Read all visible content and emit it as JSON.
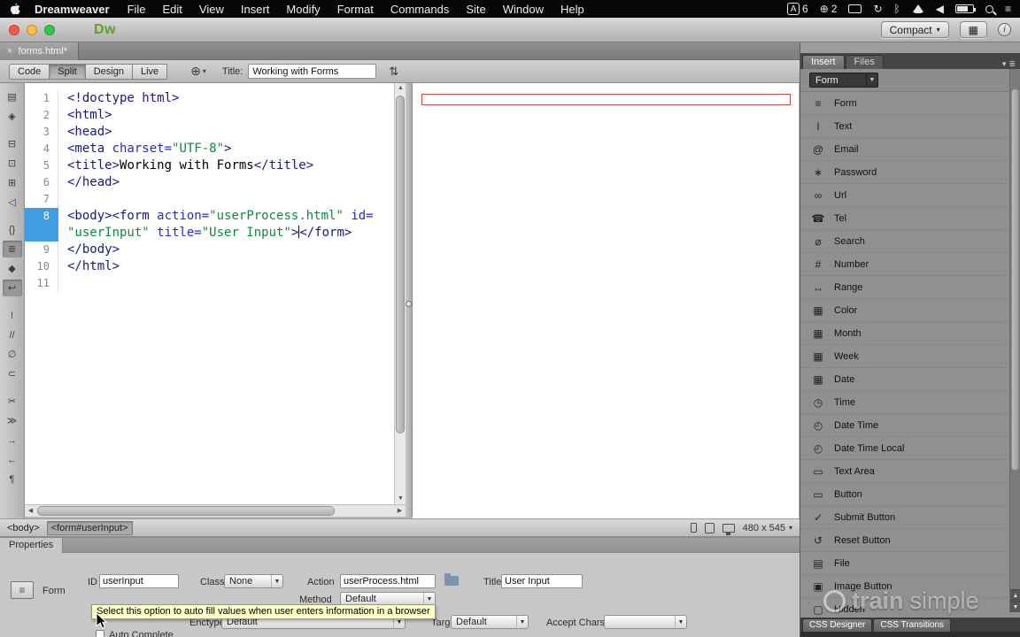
{
  "menubar": {
    "app_name": "Dreamweaver",
    "menus": [
      {
        "label": "File"
      },
      {
        "label": "Edit"
      },
      {
        "label": "View"
      },
      {
        "label": "Insert"
      },
      {
        "label": "Modify"
      },
      {
        "label": "Format"
      },
      {
        "label": "Commands"
      },
      {
        "label": "Site"
      },
      {
        "label": "Window"
      },
      {
        "label": "Help"
      }
    ],
    "input_badge": "6",
    "network_badge": "2"
  },
  "icons": {
    "input_a": "A",
    "globe": "⊕",
    "sync": "↻",
    "bluetooth": "ᛒ",
    "volume": "◀",
    "hamburger": "≡",
    "chevron_small": "▾",
    "chevron_down": "▼",
    "file_transfer": "⇅",
    "workspace_grid": "▦",
    "info": "i",
    "scroll_up": "▲",
    "scroll_down": "▼",
    "scroll_left": "◀",
    "scroll_right": "▶",
    "panel_menu": "≣",
    "form_plate": "≡"
  },
  "titlebar": {
    "logo": "Dw",
    "workspace_button": "Compact"
  },
  "doc_tab": {
    "close": "×",
    "label": "forms.html*"
  },
  "doc_toolbar": {
    "view_buttons": [
      {
        "label": "Code",
        "state": ""
      },
      {
        "label": "Split",
        "state": "active"
      },
      {
        "label": "Design",
        "state": ""
      },
      {
        "label": "Live",
        "state": ""
      }
    ],
    "title_label": "Title:",
    "title_value": "Working with Forms"
  },
  "left_toolbar": {
    "icons": [
      {
        "name": "open-documents-icon",
        "glyph": "▤",
        "state": ""
      },
      {
        "name": "code-navigator-icon",
        "glyph": "◈",
        "state": ""
      },
      {
        "name": "collapse-full-tag-icon",
        "glyph": "⊟",
        "state": ""
      },
      {
        "name": "collapse-selection-icon",
        "glyph": "⊡",
        "state": ""
      },
      {
        "name": "expand-all-icon",
        "glyph": "⊞",
        "state": ""
      },
      {
        "name": "select-parent-tag-icon",
        "glyph": "◁",
        "state": ""
      },
      {
        "name": "balance-braces-icon",
        "glyph": "{}",
        "state": ""
      },
      {
        "name": "line-numbers-icon",
        "glyph": "≣",
        "state": "active"
      },
      {
        "name": "highlight-invalid-code-icon",
        "glyph": "◆",
        "state": ""
      },
      {
        "name": "word-wrap-icon",
        "glyph": "↩",
        "state": "active"
      },
      {
        "name": "syntax-error-alerts-icon",
        "glyph": "!",
        "state": ""
      },
      {
        "name": "apply-comment-icon",
        "glyph": "//",
        "state": ""
      },
      {
        "name": "remove-comment-icon",
        "glyph": "∅",
        "state": ""
      },
      {
        "name": "wrap-tag-icon",
        "glyph": "⊂",
        "state": ""
      },
      {
        "name": "recent-snippets-icon",
        "glyph": "✂",
        "state": ""
      },
      {
        "name": "move-css-icon",
        "glyph": "≫",
        "state": ""
      },
      {
        "name": "indent-icon",
        "glyph": "→",
        "state": ""
      },
      {
        "name": "outdent-icon",
        "glyph": "←",
        "state": ""
      },
      {
        "name": "format-source-icon",
        "glyph": "¶",
        "state": ""
      }
    ]
  },
  "code": {
    "line1": {
      "num": "1",
      "t1": "<!doctype html>"
    },
    "line2": {
      "num": "2",
      "t1": "<html>"
    },
    "line3": {
      "num": "3",
      "t1": "<head>"
    },
    "line4": {
      "num": "4",
      "t1": "<meta ",
      "a1": "charset=",
      "s1": "\"UTF-8\"",
      "t2": ">"
    },
    "line5": {
      "num": "5",
      "t1": "<title>",
      "x1": "Working with Forms",
      "t2": "</title>"
    },
    "line6": {
      "num": "6",
      "t1": "</head>"
    },
    "line7": {
      "num": "7"
    },
    "line8a": {
      "num": "8",
      "t1": "<body><form ",
      "a1": "action=",
      "s1": "\"userProcess.html\"",
      "a2": " id="
    },
    "line8b": {
      "s1": "\"userInput\"",
      "a1": " title=",
      "s2": "\"User Input\"",
      "t1": ">",
      "t2": "</form>"
    },
    "line9": {
      "num": "9",
      "t1": "</body>"
    },
    "line10": {
      "num": "10",
      "t1": "</html>"
    },
    "line11": {
      "num": "11"
    }
  },
  "status_bar": {
    "tag_body": "<body>",
    "tag_form": "<form#userInput>",
    "window_size": "480 x 545"
  },
  "insert_panel": {
    "tab_insert": "Insert",
    "tab_files": "Files",
    "category_select": "Form",
    "items": [
      {
        "icon": "form-icon",
        "glyph": "≡",
        "label": "Form"
      },
      {
        "icon": "text-field-icon",
        "glyph": "I",
        "label": "Text"
      },
      {
        "icon": "email-icon",
        "glyph": "@",
        "label": "Email"
      },
      {
        "icon": "password-icon",
        "glyph": "∗",
        "label": "Password"
      },
      {
        "icon": "url-icon",
        "glyph": "∞",
        "label": "Url"
      },
      {
        "icon": "tel-icon",
        "glyph": "☎",
        "label": "Tel"
      },
      {
        "icon": "search-icon",
        "glyph": "⌀",
        "label": "Search"
      },
      {
        "icon": "number-icon",
        "glyph": "#",
        "label": "Number"
      },
      {
        "icon": "range-icon",
        "glyph": "↔",
        "label": "Range"
      },
      {
        "icon": "color-icon",
        "glyph": "▦",
        "label": "Color"
      },
      {
        "icon": "month-icon",
        "glyph": "▦",
        "label": "Month"
      },
      {
        "icon": "week-icon",
        "glyph": "▦",
        "label": "Week"
      },
      {
        "icon": "date-icon",
        "glyph": "▦",
        "label": "Date"
      },
      {
        "icon": "time-icon",
        "glyph": "◷",
        "label": "Time"
      },
      {
        "icon": "date-time-icon",
        "glyph": "◴",
        "label": "Date Time"
      },
      {
        "icon": "date-time-local-icon",
        "glyph": "◴",
        "label": "Date Time Local"
      },
      {
        "icon": "text-area-icon",
        "glyph": "▭",
        "label": "Text Area"
      },
      {
        "icon": "button-icon",
        "glyph": "▭",
        "label": "Button"
      },
      {
        "icon": "submit-button-icon",
        "glyph": "✓",
        "label": "Submit Button"
      },
      {
        "icon": "reset-button-icon",
        "glyph": "↺",
        "label": "Reset Button"
      },
      {
        "icon": "file-icon",
        "glyph": "▤",
        "label": "File"
      },
      {
        "icon": "image-button-icon",
        "glyph": "▣",
        "label": "Image Button"
      },
      {
        "icon": "hidden-icon",
        "glyph": "▢",
        "label": "Hidden"
      }
    ],
    "bottom_tabs": [
      {
        "label": "CSS Designer"
      },
      {
        "label": "CSS Transitions"
      }
    ]
  },
  "properties": {
    "tab_label": "Properties",
    "element_label": "Form",
    "id_label": "ID",
    "id_value": "userInput",
    "class_label": "Class",
    "class_value": "None",
    "action_label": "Action",
    "action_value": "userProcess.html",
    "title_label": "Title",
    "title_value": "User Input",
    "method_label": "Method",
    "method_value": "Default",
    "enctype_label": "Enctype",
    "enctype_value": "Default",
    "target_label": "Target",
    "target_value": "Default",
    "accept_charset_label": "Accept Charset",
    "accept_charset_value": "",
    "autocomplete_label": "Auto Complete",
    "tooltip": "Select this option to auto fill values when user enters information in a browser"
  },
  "watermark": {
    "word1": "train",
    "word2": "simple"
  }
}
